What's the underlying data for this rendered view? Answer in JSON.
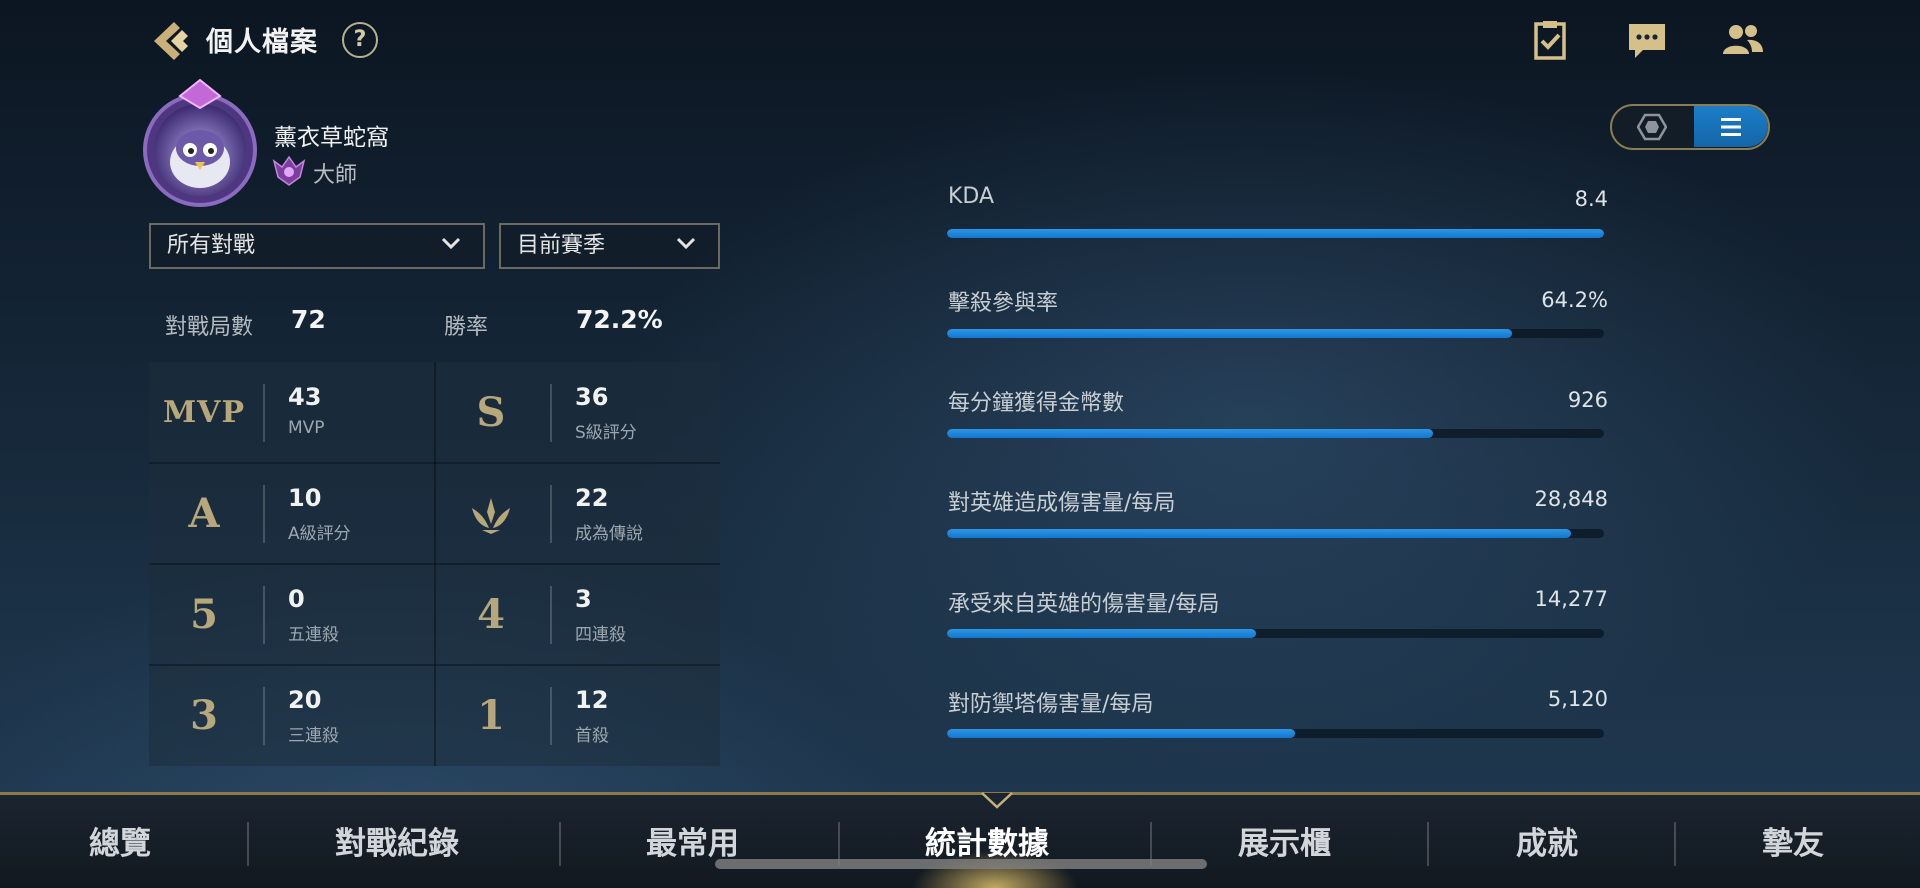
{
  "header": {
    "title": "個人檔案",
    "help_glyph": "?",
    "icons": [
      "back-icon",
      "help-icon",
      "checklist-icon",
      "chat-icon",
      "friends-icon"
    ]
  },
  "profile": {
    "name": "薰衣草蛇窩",
    "rank": "大師"
  },
  "filters": {
    "mode": "所有對戰",
    "season": "目前賽季"
  },
  "summary": {
    "games_label": "對戰局數",
    "games_value": "72",
    "winrate_label": "勝率",
    "winrate_value": "72.2%"
  },
  "stats": [
    {
      "symbol": "MVP",
      "value": "43",
      "label": "MVP"
    },
    {
      "symbol": "S",
      "value": "36",
      "label": "S級評分"
    },
    {
      "symbol": "A",
      "value": "10",
      "label": "A級評分"
    },
    {
      "symbol": "legend-icon",
      "value": "22",
      "label": "成為傳說"
    },
    {
      "symbol": "5",
      "value": "0",
      "label": "五連殺"
    },
    {
      "symbol": "4",
      "value": "3",
      "label": "四連殺"
    },
    {
      "symbol": "3",
      "value": "20",
      "label": "三連殺"
    },
    {
      "symbol": "1",
      "value": "12",
      "label": "首殺"
    }
  ],
  "metrics": [
    {
      "label": "KDA",
      "value": "8.4",
      "fraction": 1.0
    },
    {
      "label": "擊殺參與率",
      "value": "64.2%",
      "fraction": 0.86
    },
    {
      "label": "每分鐘獲得金幣數",
      "value": "926",
      "fraction": 0.74
    },
    {
      "label": "對英雄造成傷害量/每局",
      "value": "28,848",
      "fraction": 0.95
    },
    {
      "label": "承受來自英雄的傷害量/每局",
      "value": "14,277",
      "fraction": 0.47
    },
    {
      "label": "對防禦塔傷害量/每局",
      "value": "5,120",
      "fraction": 0.53
    }
  ],
  "nav": {
    "tabs": [
      "總覽",
      "對戰紀錄",
      "最常用",
      "統計數據",
      "展示櫃",
      "成就",
      "摯友"
    ],
    "active_tab": "統計數據"
  },
  "colors": {
    "accent_gold": "#b7a77a",
    "bar_blue": "#1e88dc",
    "background": "#162a3c"
  }
}
